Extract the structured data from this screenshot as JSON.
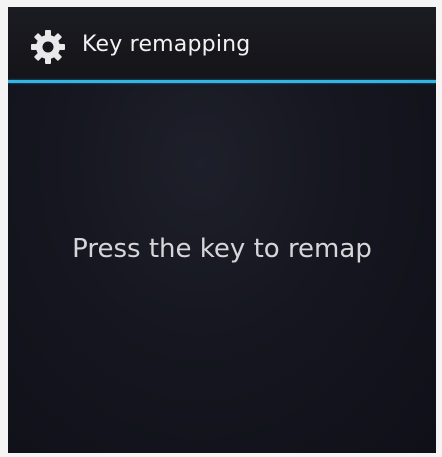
{
  "action_bar": {
    "icon": "gear-icon",
    "title": "Key remapping"
  },
  "accent_color": "#33b5e5",
  "main": {
    "message": "Press the key to remap"
  }
}
